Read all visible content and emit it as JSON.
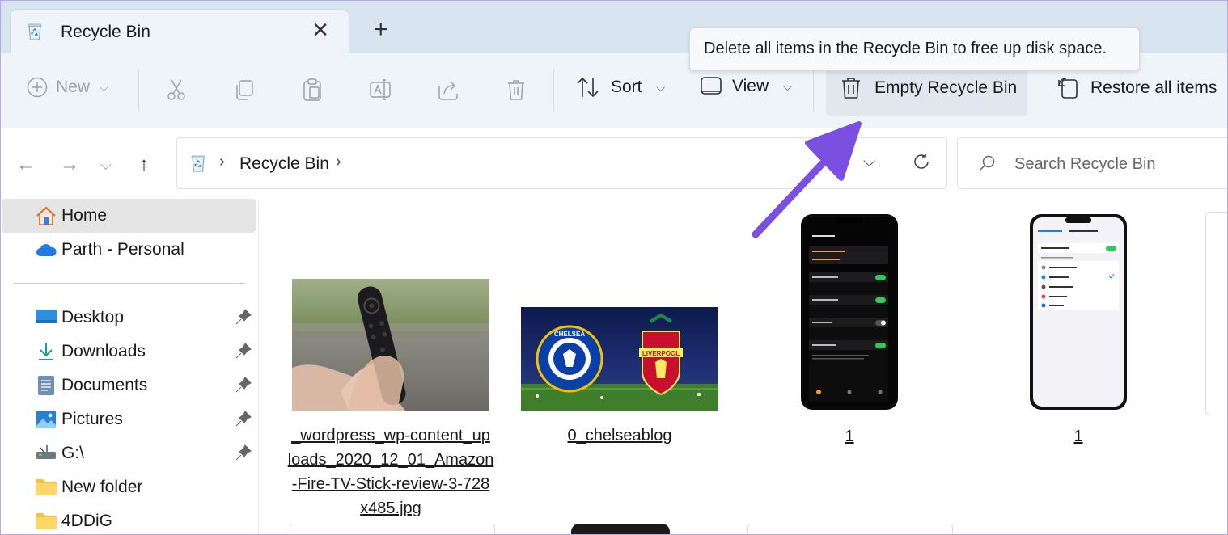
{
  "window": {
    "tab_title": "Recycle Bin",
    "close_glyph": "✕",
    "new_tab_glyph": "+"
  },
  "toolbar": {
    "new_label": "New",
    "sort_label": "Sort",
    "view_label": "View",
    "empty_label": "Empty Recycle Bin",
    "restore_label": "Restore all items",
    "tooltip": "Delete all items in the Recycle Bin to free up disk space."
  },
  "address": {
    "crumb": "Recycle Bin",
    "search_placeholder": "Search Recycle Bin"
  },
  "sidebar": {
    "items": [
      {
        "label": "Home",
        "icon": "home-icon"
      },
      {
        "label": "Parth - Personal",
        "icon": "onedrive-cloud-icon"
      },
      {
        "label": "Desktop",
        "icon": "desktop-icon"
      },
      {
        "label": "Downloads",
        "icon": "downloads-icon"
      },
      {
        "label": "Documents",
        "icon": "documents-icon"
      },
      {
        "label": "Pictures",
        "icon": "pictures-icon"
      },
      {
        "label": "G:\\",
        "icon": "drive-icon"
      },
      {
        "label": "New folder",
        "icon": "folder-icon"
      },
      {
        "label": "4DDiG",
        "icon": "folder-icon"
      }
    ]
  },
  "files": [
    {
      "name": "_wordpress_wp-content_uploads_2020_12_01_Amazon-Fire-TV-Stick-review-3-728x485.jpg",
      "lines": [
        "_wordpress_wp-content_up",
        "loads_2020_12_01_Amazon",
        "-Fire-TV-Stick-review-3-728",
        "x485.jpg"
      ]
    },
    {
      "name": "0_chelseablog",
      "badge_left": "CHELSEA",
      "badge_right": "LIVERPOOL"
    },
    {
      "name": "1"
    },
    {
      "name": "1"
    }
  ],
  "colors": {
    "accent": "#0067c0",
    "arrow": "#7b4fe0",
    "tabstrip": "#d9e4f1",
    "commandbar": "#eff4f9"
  }
}
